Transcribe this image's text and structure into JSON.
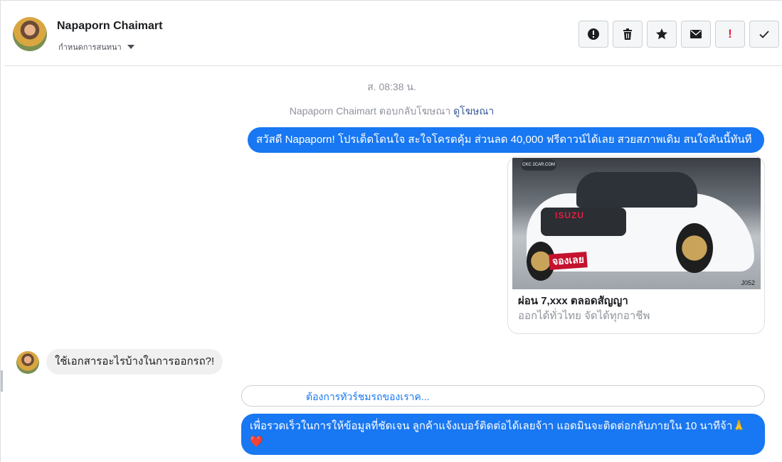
{
  "conversation": {
    "contact_name": "Napaporn Chaimart",
    "assign_label": "กำหนดการสนทนา",
    "timestamp": "ส. 08:38 น.",
    "reply_note_prefix": "Napaporn Chaimart ตอบกลับโฆษณา",
    "reply_note_link": "ดูโฆษณา"
  },
  "toolbar": {
    "actions": [
      {
        "icon": "alert-icon",
        "label": "!"
      },
      {
        "icon": "trash-icon"
      },
      {
        "icon": "star-icon"
      },
      {
        "icon": "envelope-icon"
      },
      {
        "icon": "exclamation-icon",
        "label": "!"
      },
      {
        "icon": "checkmark-icon"
      }
    ],
    "bang": "!"
  },
  "messages": [
    {
      "direction": "out",
      "text": "สวัสดี Napaporn! โปรเด็ดโดนใจ สะใจโครตคุ้ม ส่วนลด 40,000 ฟรีดาวน์ได้เลย สวยสภาพเดิม สนใจคันนี้ทันที"
    },
    {
      "direction": "out",
      "type": "ad-card",
      "title": "ผ่อน 7,xxx ตลอดสัญญา",
      "subtitle": "ออกได้ทั่วไทย จัดได้ทุกอาชีพ",
      "image_text": {
        "logo": "CKC 2CAR.COM",
        "brand": "ISUZU",
        "stamp": "จองเลย",
        "code": "J052"
      }
    },
    {
      "direction": "in",
      "text": "ใช้เอกสารอะไรบ้างในการออกรถ?!"
    },
    {
      "direction": "out",
      "type": "quick-reply",
      "text": "ต้องการทัวร์ชมรถของเราค..."
    },
    {
      "direction": "out",
      "text": "เพื่อรวดเร็วในการให้ข้อมูลที่ชัดเจน ลูกค้าแจ้งเบอร์ติดต่อได้เลยจ้าา แอดมินจะติดต่อกลับภายใน 10 นาทีจ้า🙏 ❤️"
    }
  ],
  "colors": {
    "accent": "#1877f2",
    "incoming_bubble": "#f0f0f0",
    "muted_text": "#90949c",
    "danger": "#e41e3f"
  }
}
